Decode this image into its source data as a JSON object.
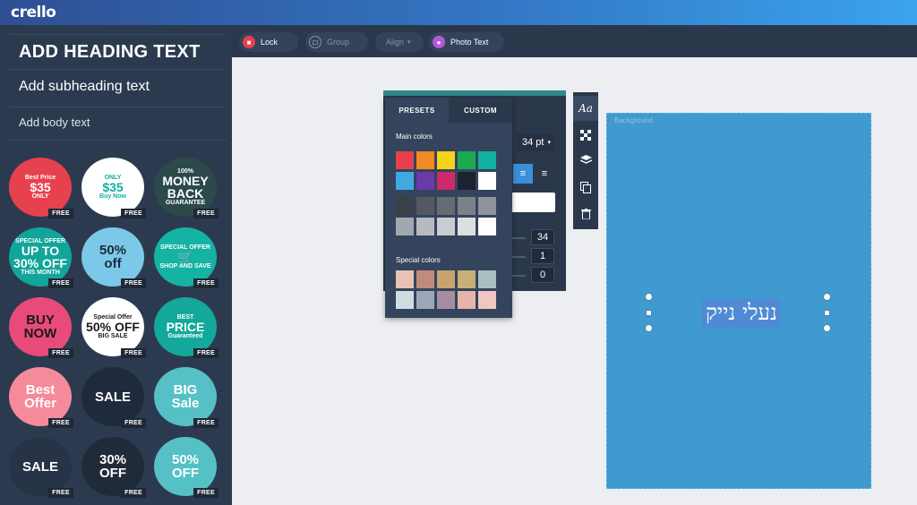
{
  "app": {
    "logo": "crello"
  },
  "sidebar": {
    "heading_text": "ADD HEADING TEXT",
    "subheading_text": "Add subheading text",
    "body_text": "Add body text",
    "free_label": "FREE",
    "stickers": [
      {
        "lines": [
          "Best Price",
          "$35",
          "ONLY"
        ],
        "bg": "#e8414e",
        "fg": "#ffffff"
      },
      {
        "lines": [
          "ONLY",
          "$35",
          "Buy Now"
        ],
        "bg": "#ffffff",
        "fg": "#13b0a0"
      },
      {
        "lines": [
          "100%",
          "MONEY BACK",
          "GUARANTEE"
        ],
        "bg": "#2d4a4a",
        "fg": "#ffffff"
      },
      {
        "lines": [
          "SPECIAL OFFER",
          "UP TO 30% OFF",
          "THIS MONTH"
        ],
        "bg": "#12a59a",
        "fg": "#ffffff"
      },
      {
        "lines": [
          "50%",
          "off"
        ],
        "bg": "#7cc8e8",
        "fg": "#1b2a3f"
      },
      {
        "lines": [
          "SPECIAL OFFER",
          "🛒",
          "SHOP AND SAVE"
        ],
        "bg": "#15b3a2",
        "fg": "#ffffff"
      },
      {
        "lines": [
          "BUY",
          "NOW"
        ],
        "bg": "#e84a7a",
        "fg": "#1a1a1a"
      },
      {
        "lines": [
          "Special Offer",
          "50% OFF",
          "BIG SALE"
        ],
        "bg": "#ffffff",
        "fg": "#1a1a1a"
      },
      {
        "lines": [
          "BEST",
          "PRICE",
          "Guaranteed"
        ],
        "bg": "#13a89a",
        "fg": "#ffffff"
      },
      {
        "lines": [
          "Best",
          "Offer"
        ],
        "bg": "#f48a9a",
        "fg": "#ffffff"
      },
      {
        "lines": [
          "SALE"
        ],
        "bg": "#1f2b3d",
        "fg": "#ffffff"
      },
      {
        "lines": [
          "BIG",
          "Sale"
        ],
        "bg": "#55c1c7",
        "fg": "#ffffff"
      },
      {
        "lines": [
          "SALE"
        ],
        "bg": "#273447",
        "fg": "#ffffff"
      },
      {
        "lines": [
          "30%",
          "OFF"
        ],
        "bg": "#202b3a",
        "fg": "#ffffff"
      },
      {
        "lines": [
          "50%",
          "OFF"
        ],
        "bg": "#55c1c7",
        "fg": "#ffffff"
      }
    ]
  },
  "toolbar": {
    "lock_label": "Lock",
    "group_label": "Group",
    "align_label": "Align",
    "photo_text_label": "Photo Text"
  },
  "text_panel": {
    "font_size": "34 pt",
    "values": [
      "34",
      "1",
      "0"
    ]
  },
  "color_picker": {
    "tabs": [
      "PRESETS",
      "CUSTOM"
    ],
    "main_colors_label": "Main colors",
    "special_colors_label": "Special colors",
    "main_colors": [
      "#e8414e",
      "#f48a24",
      "#f5d21c",
      "#1aab50",
      "#13b0a0",
      "#3fa9e0",
      "#6a3aa8",
      "#cc2a6a",
      "#1c2230",
      "#ffffff"
    ],
    "gray_colors": [
      "#3c4048",
      "#535862",
      "#666b74",
      "#7c818a",
      "#8f949c",
      "#a3a7ae",
      "#b7bbc1",
      "#c9ccd1",
      "#dcdfe2",
      "#ffffff"
    ],
    "special_colors": [
      "#e9c2b3",
      "#c08b7a",
      "#c6a36f",
      "#c9ae7a",
      "#a9bfc0",
      "#cfdce0",
      "#9da7ba",
      "#a88ca0",
      "#e6b5a7",
      "#efc6c0"
    ]
  },
  "vertical_tools": [
    "Aa",
    "transparency-icon",
    "layers-icon",
    "copy-icon",
    "trash-icon"
  ],
  "canvas": {
    "bg_label": "Background",
    "text": "נעלי נייק"
  }
}
